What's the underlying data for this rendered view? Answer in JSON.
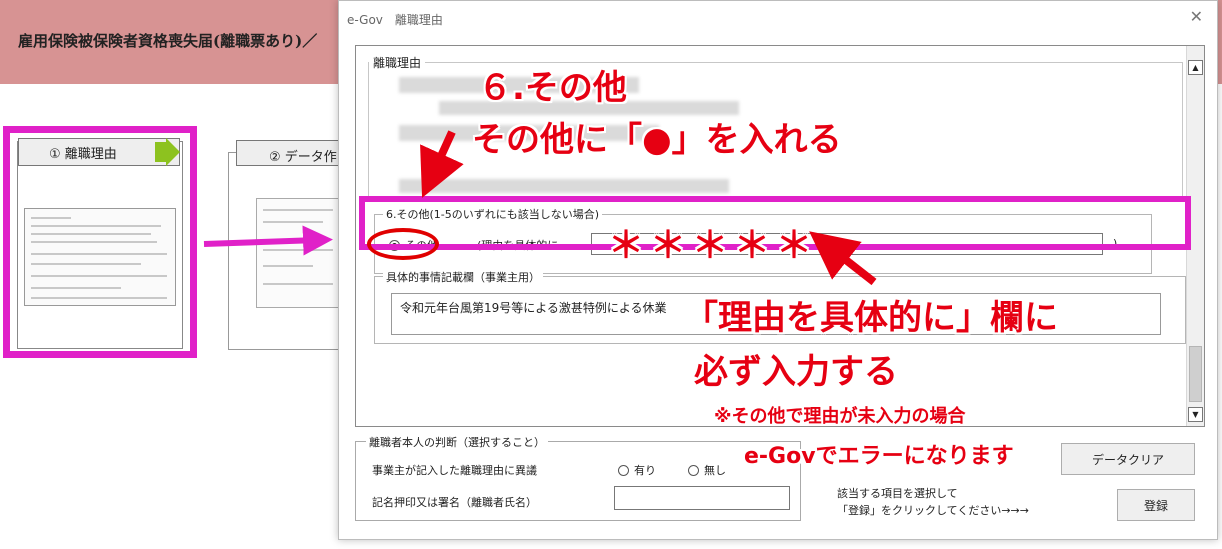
{
  "background": {
    "title": "雇用保険被保険者資格喪失届(離職票あり)／",
    "step1_label": "① 離職理由",
    "step2_label": "② データ作"
  },
  "dialog": {
    "title": "e-Gov　離職理由",
    "reason_group_label": "離職理由",
    "other": {
      "legend": "6.その他(1-5のいずれにも該当しない場合)",
      "radio_label": "その他",
      "paren_label": "(理由を具体的に",
      "paren_close": ")",
      "selected": true
    },
    "detail": {
      "legend": "具体的事情記載欄（事業主用）",
      "value": "令和元年台風第19号等による激甚特例による休業"
    },
    "judgment": {
      "legend": "離職者本人の判断（選択すること）",
      "question": "事業主が記入した離職理由に異議",
      "yes": "有り",
      "no": "無し",
      "sign_label": "記名押印又は署名（離職者氏名）"
    },
    "buttons": {
      "clear": "データクリア",
      "register": "登録"
    },
    "hint": [
      "該当する項目を選択して",
      "「登録」をクリックしてください→→→"
    ]
  },
  "annotations": {
    "line1": "６.その他",
    "line2": "その他に「●」を入れる",
    "stars": "＊＊＊＊＊",
    "line3": "「理由を具体的に」欄に",
    "line4": "必ず入力する",
    "note1": "※その他で理由が未入力の場合",
    "note2": "e-Govでエラーになります"
  },
  "colors": {
    "highlight": "#e021c8",
    "annotation": "#e60012",
    "header": "#d79393",
    "chevron": "#8dc21f"
  }
}
